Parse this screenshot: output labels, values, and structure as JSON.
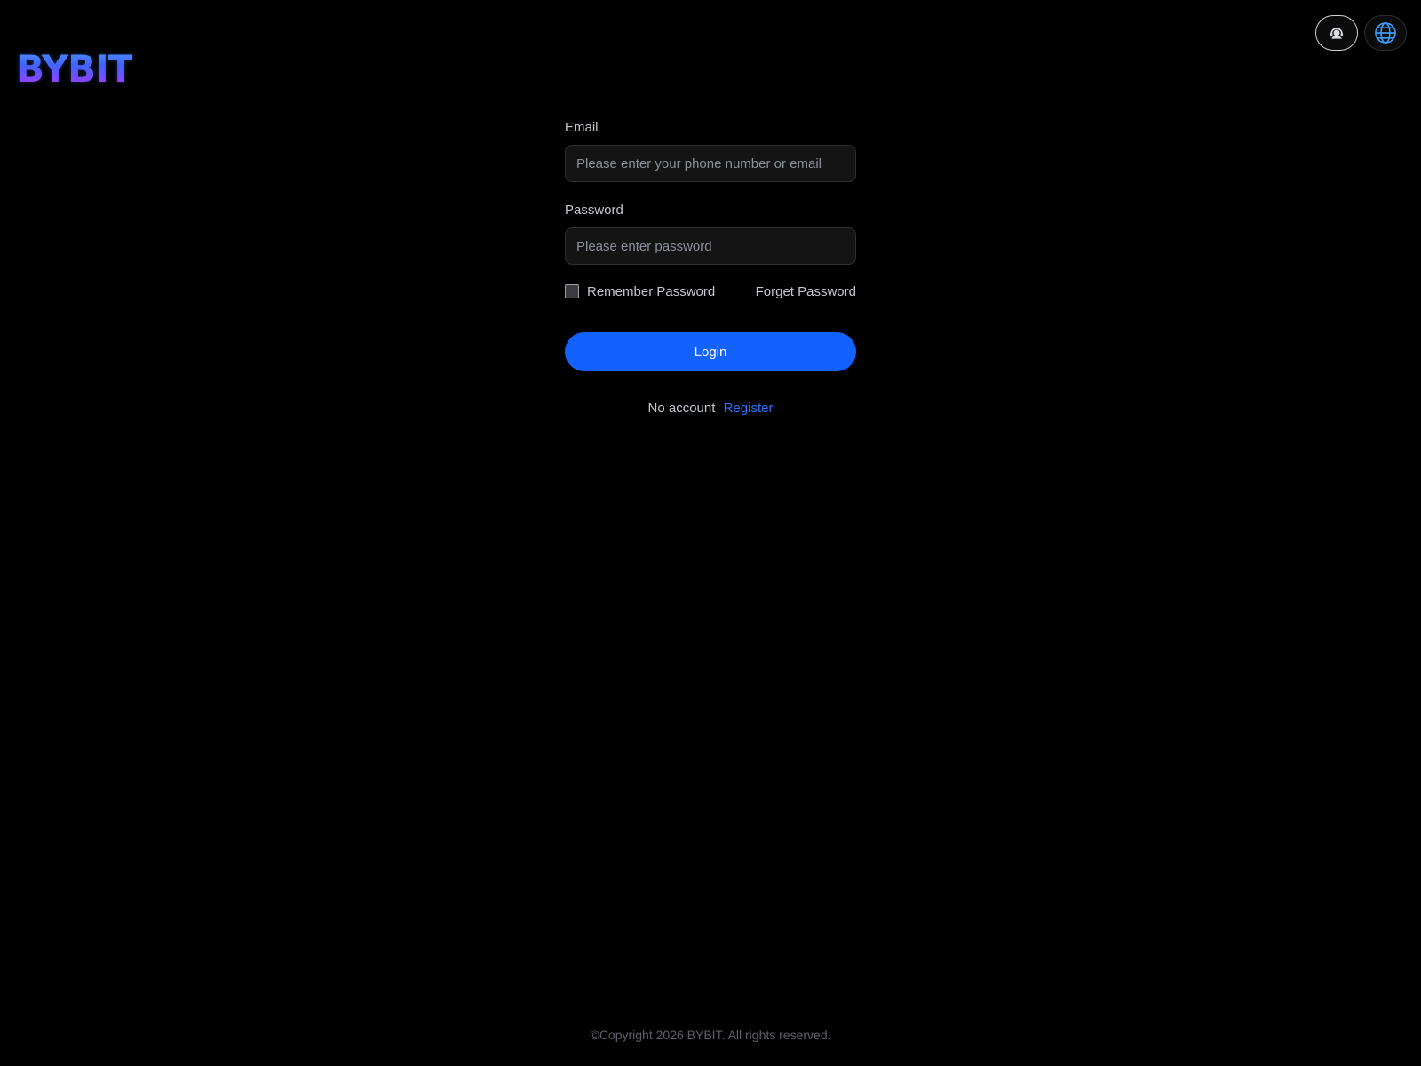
{
  "brand": {
    "logo_text": "BYBIT"
  },
  "header": {
    "actions": [
      {
        "icon": "customer-support-icon"
      },
      {
        "icon": "globe-icon"
      }
    ]
  },
  "form": {
    "email": {
      "label": "Email",
      "placeholder": "Please enter your phone number or email",
      "value": ""
    },
    "password": {
      "label": "Password",
      "placeholder": "Please enter password",
      "value": ""
    },
    "remember_label": "Remember Password",
    "remember_checked": false,
    "forget_label": "Forget Password",
    "login_label": "Login",
    "no_account_text": "No account",
    "register_label": "Register"
  },
  "footer": {
    "copyright": "©Copyright 2026 BYBIT. All rights reserved."
  },
  "colors": {
    "background": "#000000",
    "primary": "#1362ff",
    "link": "#2f72ff",
    "input_bg": "#141414"
  }
}
